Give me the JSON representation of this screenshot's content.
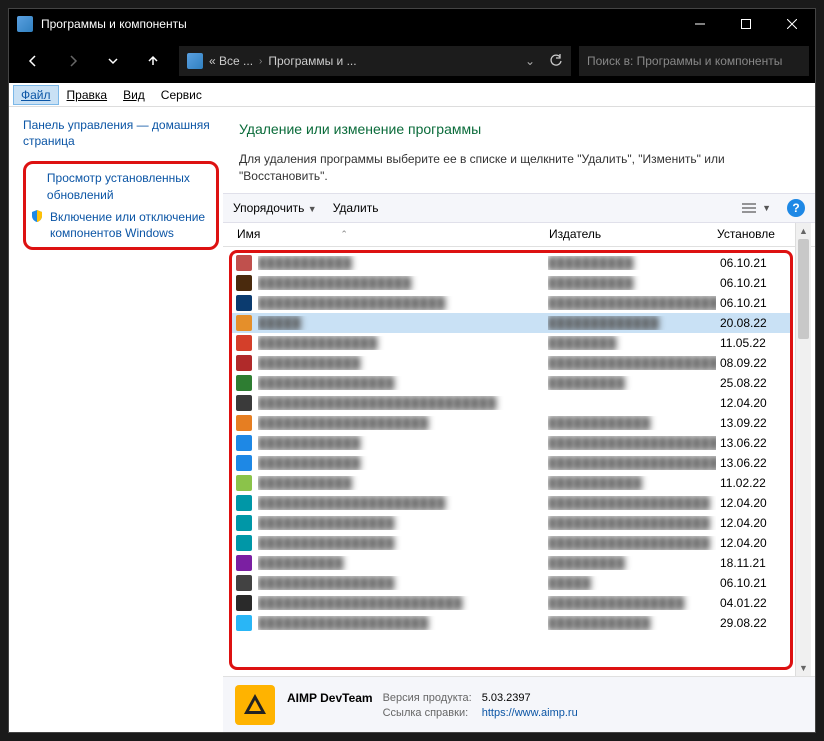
{
  "titlebar": {
    "title": "Программы и компоненты"
  },
  "breadcrumb": {
    "part1": "« Все ...",
    "part2": "Программы и ..."
  },
  "search": {
    "placeholder": "Поиск в: Программы и компоненты"
  },
  "menu": {
    "file": "Файл",
    "edit": "Правка",
    "view": "Вид",
    "service": "Сервис"
  },
  "sidebar": {
    "home": "Панель управления — домашняя страница",
    "updates": "Просмотр установленных обновлений",
    "features": "Включение или отключение компонентов Windows"
  },
  "main": {
    "heading": "Удаление или изменение программы",
    "desc": "Для удаления программы выберите ее в списке и щелкните \"Удалить\", \"Изменить\" или \"Восстановить\"."
  },
  "toolbar": {
    "organize": "Упорядочить",
    "uninstall": "Удалить"
  },
  "columns": {
    "name": "Имя",
    "publisher": "Издатель",
    "installed": "Установле"
  },
  "rows": [
    {
      "name": "███████████",
      "pub": "██████████",
      "date": "06.10.21",
      "c": "#c0504d"
    },
    {
      "name": "██████████████████",
      "pub": "██████████",
      "date": "06.10.21",
      "c": "#4a2a0d"
    },
    {
      "name": "██████████████████████",
      "pub": "████████████████████████",
      "date": "06.10.21",
      "c": "#0b3b6f"
    },
    {
      "name": "█████",
      "pub": "█████████████",
      "date": "20.08.22",
      "c": "#e58f2a",
      "sel": true
    },
    {
      "name": "██████████████",
      "pub": "████████",
      "date": "11.05.22",
      "c": "#d43f2a"
    },
    {
      "name": "████████████",
      "pub": "███████████████████████████",
      "date": "08.09.22",
      "c": "#b02a2a"
    },
    {
      "name": "████████████████",
      "pub": "█████████",
      "date": "25.08.22",
      "c": "#2e7d32"
    },
    {
      "name": "████████████████████████████",
      "pub": "",
      "date": "12.04.20",
      "c": "#3a3a3a"
    },
    {
      "name": "████████████████████",
      "pub": "████████████",
      "date": "13.09.22",
      "c": "#e67e22"
    },
    {
      "name": "████████████",
      "pub": "██████████████████████",
      "date": "13.06.22",
      "c": "#1e88e5"
    },
    {
      "name": "████████████",
      "pub": "██████████████████████",
      "date": "13.06.22",
      "c": "#1e88e5"
    },
    {
      "name": "███████████",
      "pub": "███████████",
      "date": "11.02.22",
      "c": "#8bc34a"
    },
    {
      "name": "██████████████████████",
      "pub": "███████████████████",
      "date": "12.04.20",
      "c": "#0097a7"
    },
    {
      "name": "████████████████",
      "pub": "███████████████████",
      "date": "12.04.20",
      "c": "#0097a7"
    },
    {
      "name": "████████████████",
      "pub": "███████████████████",
      "date": "12.04.20",
      "c": "#0097a7"
    },
    {
      "name": "██████████",
      "pub": "█████████",
      "date": "18.11.21",
      "c": "#7b1fa2"
    },
    {
      "name": "████████████████",
      "pub": "█████",
      "date": "06.10.21",
      "c": "#424242"
    },
    {
      "name": "████████████████████████",
      "pub": "████████████████",
      "date": "04.01.22",
      "c": "#2a2a2a"
    },
    {
      "name": "████████████████████",
      "pub": "████████████",
      "date": "29.08.22",
      "c": "#29b6f6"
    }
  ],
  "details": {
    "brand": "AIMP DevTeam",
    "ver_label": "Версия продукта:",
    "ver": "5.03.2397",
    "help_label": "Ссылка справки:",
    "help": "https://www.aimp.ru"
  }
}
